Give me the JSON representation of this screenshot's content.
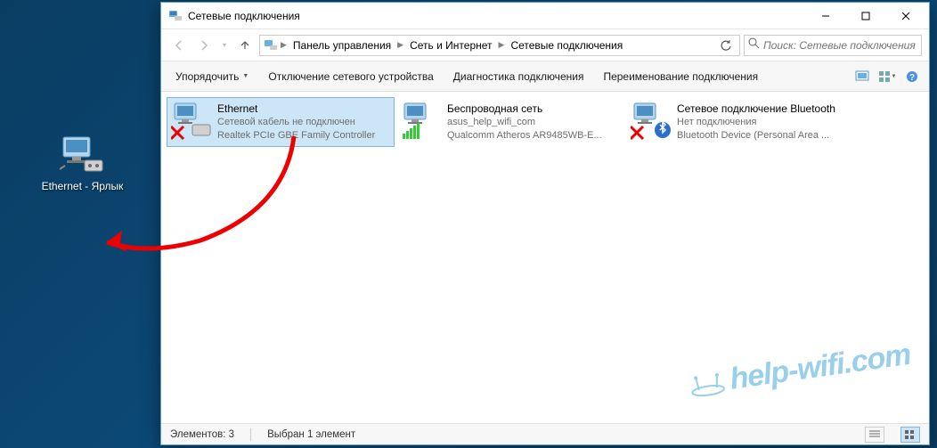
{
  "desktop": {
    "shortcut": {
      "name": "Ethernet - Ярлык"
    }
  },
  "window": {
    "title": "Сетевые подключения",
    "breadcrumb": {
      "seg1": "Панель управления",
      "seg2": "Сеть и Интернет",
      "seg3": "Сетевые подключения"
    },
    "search_placeholder": "Поиск: Сетевые подключения",
    "commands": {
      "organize": "Упорядочить",
      "disable": "Отключение сетевого устройства",
      "diagnose": "Диагностика подключения",
      "rename": "Переименование подключения"
    },
    "items": [
      {
        "name": "Ethernet",
        "status": "Сетевой кабель не подключен",
        "device": "Realtek PCIe GBE Family Controller",
        "selected": true,
        "type": "ethernet-disconnected"
      },
      {
        "name": "Беспроводная сеть",
        "status": "asus_help_wifi_com",
        "device": "Qualcomm Atheros AR9485WB-E...",
        "selected": false,
        "type": "wifi"
      },
      {
        "name": "Сетевое подключение Bluetooth",
        "status": "Нет подключения",
        "device": "Bluetooth Device (Personal Area ...",
        "selected": false,
        "type": "bluetooth"
      }
    ],
    "status": {
      "count_label": "Элементов: 3",
      "selection_label": "Выбран 1 элемент"
    }
  },
  "watermark": "help-wifi.com"
}
